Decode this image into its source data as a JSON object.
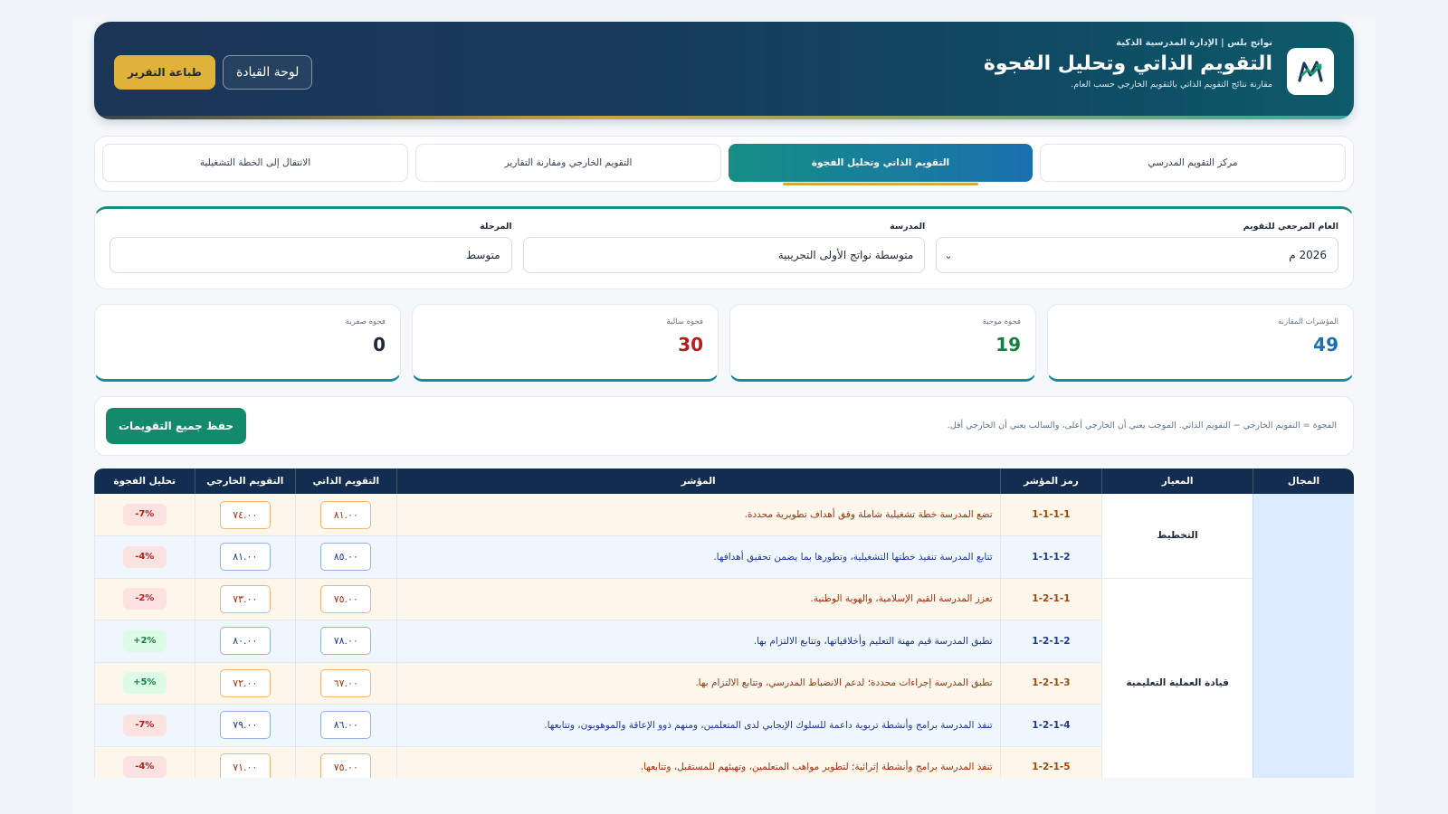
{
  "header": {
    "subtitle": "نواتج بلس | الإدارة المدرسية الذكية",
    "title": "التقويم الذاتي وتحليل الفجوة",
    "description": "مقارنة نتائج التقويم الذاتي بالتقويم الخارجي حسب العام.",
    "print_label": "طباعة التقرير",
    "dashboard_label": "لوحة القيادة"
  },
  "tabs": [
    {
      "label": "مركز التقويم المدرسي"
    },
    {
      "label": "التقويم الذاتي وتحليل الفجوة"
    },
    {
      "label": "التقويم الخارجي ومقارنة التقارير"
    },
    {
      "label": "الانتقال إلى الخطة التشغيلية"
    }
  ],
  "filters": {
    "year_label": "العام المرجعي للتقويم",
    "year_value": "2026 م",
    "school_label": "المدرسة",
    "school_value": "متوسطة نواتج الأولى التجريبية",
    "stage_label": "المرحلة",
    "stage_value": "متوسط"
  },
  "stats": [
    {
      "label": "المؤشرات المقارنة",
      "value": "49",
      "color": "#1b6fb3"
    },
    {
      "label": "فجوة موجبة",
      "value": "19",
      "color": "#15803d"
    },
    {
      "label": "فجوة سالبة",
      "value": "30",
      "color": "#b91c1c"
    },
    {
      "label": "فجوة صفرية",
      "value": "0",
      "color": "#1e293b"
    }
  ],
  "action_bar": {
    "note": "الفجوة = التقويم الخارجي − التقويم الذاتي. الموجب يعني أن الخارجي أعلى، والسالب يعني أن الخارجي أقل.",
    "save_label": "حفظ جميع التقويمات"
  },
  "table": {
    "headers": {
      "domain": "المجال",
      "standard": "المعيار",
      "code": "رمز المؤشر",
      "indicator": "المؤشر",
      "self": "التقويم الذاتي",
      "external": "التقويم الخارجي",
      "gap": "تحليل الفجوة"
    },
    "standards": [
      "التخطيط",
      "قيادة العملية التعليمية"
    ],
    "rows": [
      {
        "code": "1-1-1-1",
        "indicator": "تضع المدرسة خطة تشغيلية شاملة وفق أهداف تطويرية محددة.",
        "self": "٨١.٠٠",
        "external": "٧٤.٠٠",
        "gap": "-7%"
      },
      {
        "code": "1-1-1-2",
        "indicator": "تتابع المدرسة تنفيذ خطتها التشغيلية، وتطورها بما يضمن تحقيق أهدافها.",
        "self": "٨٥.٠٠",
        "external": "٨١.٠٠",
        "gap": "-4%"
      },
      {
        "code": "1-2-1-1",
        "indicator": "تعزز المدرسة القيم الإسلامية، والهوية الوطنية.",
        "self": "٧٥.٠٠",
        "external": "٧٣.٠٠",
        "gap": "-2%"
      },
      {
        "code": "1-2-1-2",
        "indicator": "تطبق المدرسة قيم مهنة التعليم وأخلاقياتها، وتتابع الالتزام بها.",
        "self": "٧٨.٠٠",
        "external": "٨٠.٠٠",
        "gap": "+2%"
      },
      {
        "code": "1-2-1-3",
        "indicator": "تطبق المدرسة إجراءات محددة؛ لدعم الانضباط المدرسي، وتتابع الالتزام بها.",
        "self": "٦٧.٠٠",
        "external": "٧٢.٠٠",
        "gap": "+5%"
      },
      {
        "code": "1-2-1-4",
        "indicator": "تنفذ المدرسة برامج وأنشطة تربوية داعمة للسلوك الإيجابي لدى المتعلمين، ومنهم ذوو الإعاقة والموهوبون، وتتابعها.",
        "self": "٨٦.٠٠",
        "external": "٧٩.٠٠",
        "gap": "-7%"
      },
      {
        "code": "1-2-1-5",
        "indicator": "تنفذ المدرسة برامج وأنشطة إثرائية؛ لتطوير مواهب المتعلمين، وتهيئهم للمستقبل، وتتابعها.",
        "self": "٧٥.٠٠",
        "external": "٧١.٠٠",
        "gap": "-4%"
      }
    ]
  }
}
